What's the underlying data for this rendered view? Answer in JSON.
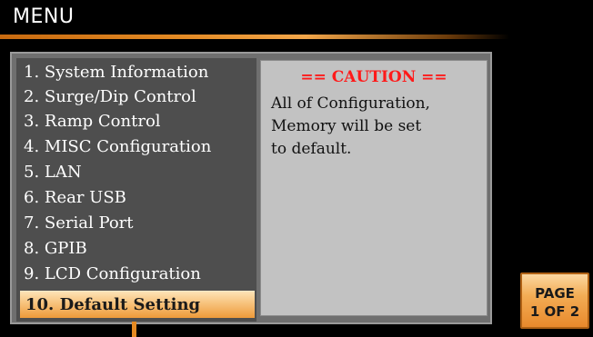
{
  "header": {
    "title": "MENU"
  },
  "menu": {
    "items": [
      {
        "label": "1. System Information"
      },
      {
        "label": "2. Surge/Dip Control"
      },
      {
        "label": "3. Ramp Control"
      },
      {
        "label": "4. MISC Configuration"
      },
      {
        "label": "5. LAN"
      },
      {
        "label": "6. Rear USB"
      },
      {
        "label": "7. Serial Port"
      },
      {
        "label": "8. GPIB"
      },
      {
        "label": "9. LCD Configuration"
      },
      {
        "label": "10. Default Setting",
        "selected": true
      }
    ],
    "selected_index": 9
  },
  "info": {
    "caution": "== CAUTION ==",
    "lines": [
      "All of Configuration,",
      "Memory will be set",
      "to default."
    ]
  },
  "soft_key": {
    "line1": "PAGE",
    "line2": "1 OF 2"
  },
  "colors": {
    "accent": "#e58a22",
    "caution": "#ff1a1a",
    "background": "#000000",
    "panel": "#c2c2c2"
  }
}
